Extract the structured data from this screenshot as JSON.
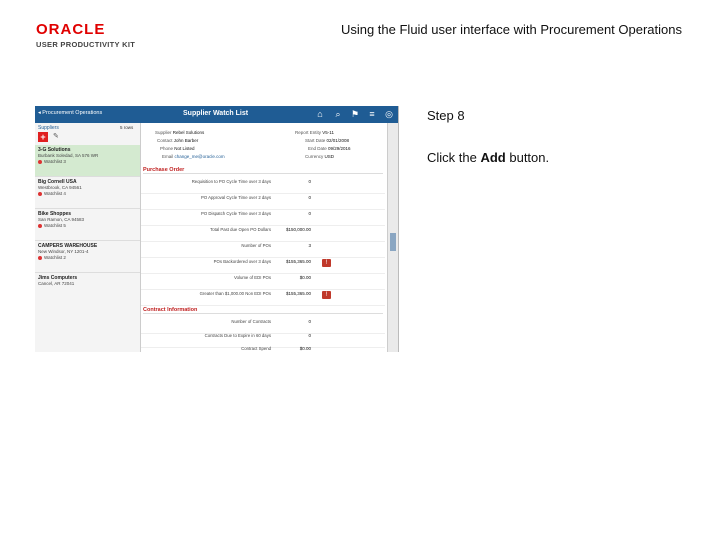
{
  "header": {
    "logo_text": "ORACLE",
    "logo_sub": "USER PRODUCTIVITY KIT",
    "page_title": "Using the Fluid user interface with Procurement Operations"
  },
  "instructions": {
    "step": "Step 8",
    "text_before": "Click the ",
    "text_bold": "Add",
    "text_after": " button."
  },
  "app": {
    "back_label": "◂ Procurement Operations",
    "title": "Supplier Watch List",
    "nav_icons": [
      "home-icon",
      "search-icon",
      "flag-icon",
      "menu-icon",
      "compass-icon"
    ],
    "left": {
      "heading": "Suppliers",
      "count": "5 rows",
      "add_symbol": "+",
      "suppliers": [
        {
          "name": "3-G Solutions",
          "address": "Burbank Soledad, SA 576 WR",
          "watch": "Watchlist 3"
        },
        {
          "name": "Big Cornell USA",
          "address": "Westbrook, CA 94561",
          "watch": "Watchlist 4"
        },
        {
          "name": "Bike Shoppes",
          "address": "San Ramon, CA 94583",
          "watch": "Watchlist 5"
        },
        {
          "name": "CAMPERS WAREHOUSE",
          "address": "New Windsor, NY 1201-4",
          "watch": "Watchlist 2"
        },
        {
          "name": "Jims Computers",
          "address": "Cancel, AR 72041",
          "watch": ""
        }
      ]
    },
    "detail": {
      "supplier_label": "Supplier",
      "supplier_value": "Rebel Solutions",
      "contact_label": "Contact",
      "contact_value": "John Barber",
      "phone_label": "Phone",
      "phone_value": "Not Listed",
      "email_label": "Email",
      "email_value": "change_me@oracle.com",
      "report_label": "Report Entity",
      "report_value": "V5-11",
      "start_label": "Start Date",
      "start_value": "02/01/2008",
      "end_label": "End Date",
      "end_value": "09/29/2016",
      "currency_label": "Currency",
      "currency_value": "USD"
    },
    "purchase_order": {
      "heading": "Purchase Order",
      "rows": [
        {
          "label": "Requisition to PO Cycle Time over 3 days",
          "value": "0",
          "alert": false
        },
        {
          "label": "PO Approval Cycle Time over 2 days",
          "value": "0",
          "alert": false
        },
        {
          "label": "PO Dispatch Cycle Time over 3 days",
          "value": "0",
          "alert": false
        },
        {
          "label": "Total Past due Open PO Dollars",
          "value": "$150,000.00",
          "alert": false
        },
        {
          "label": "Number of POs",
          "value": "3",
          "alert": false
        },
        {
          "label": "POs Backordered over 3 days",
          "value": "$155,365.00",
          "alert": true
        },
        {
          "label": "Volume of EDI POs",
          "value": "$0.00",
          "alert": false
        },
        {
          "label": "Greater than $1,000.00 Non EDI POs",
          "value": "$155,365.00",
          "alert": true
        }
      ]
    },
    "contract": {
      "heading": "Contract Information",
      "rows": [
        {
          "label": "Number of Contracts",
          "value": "0"
        },
        {
          "label": "Contracts Due to Expire in 60 days",
          "value": "0"
        },
        {
          "label": "Contract Spend",
          "value": "$0.00"
        }
      ]
    },
    "alert_symbol": "!"
  }
}
